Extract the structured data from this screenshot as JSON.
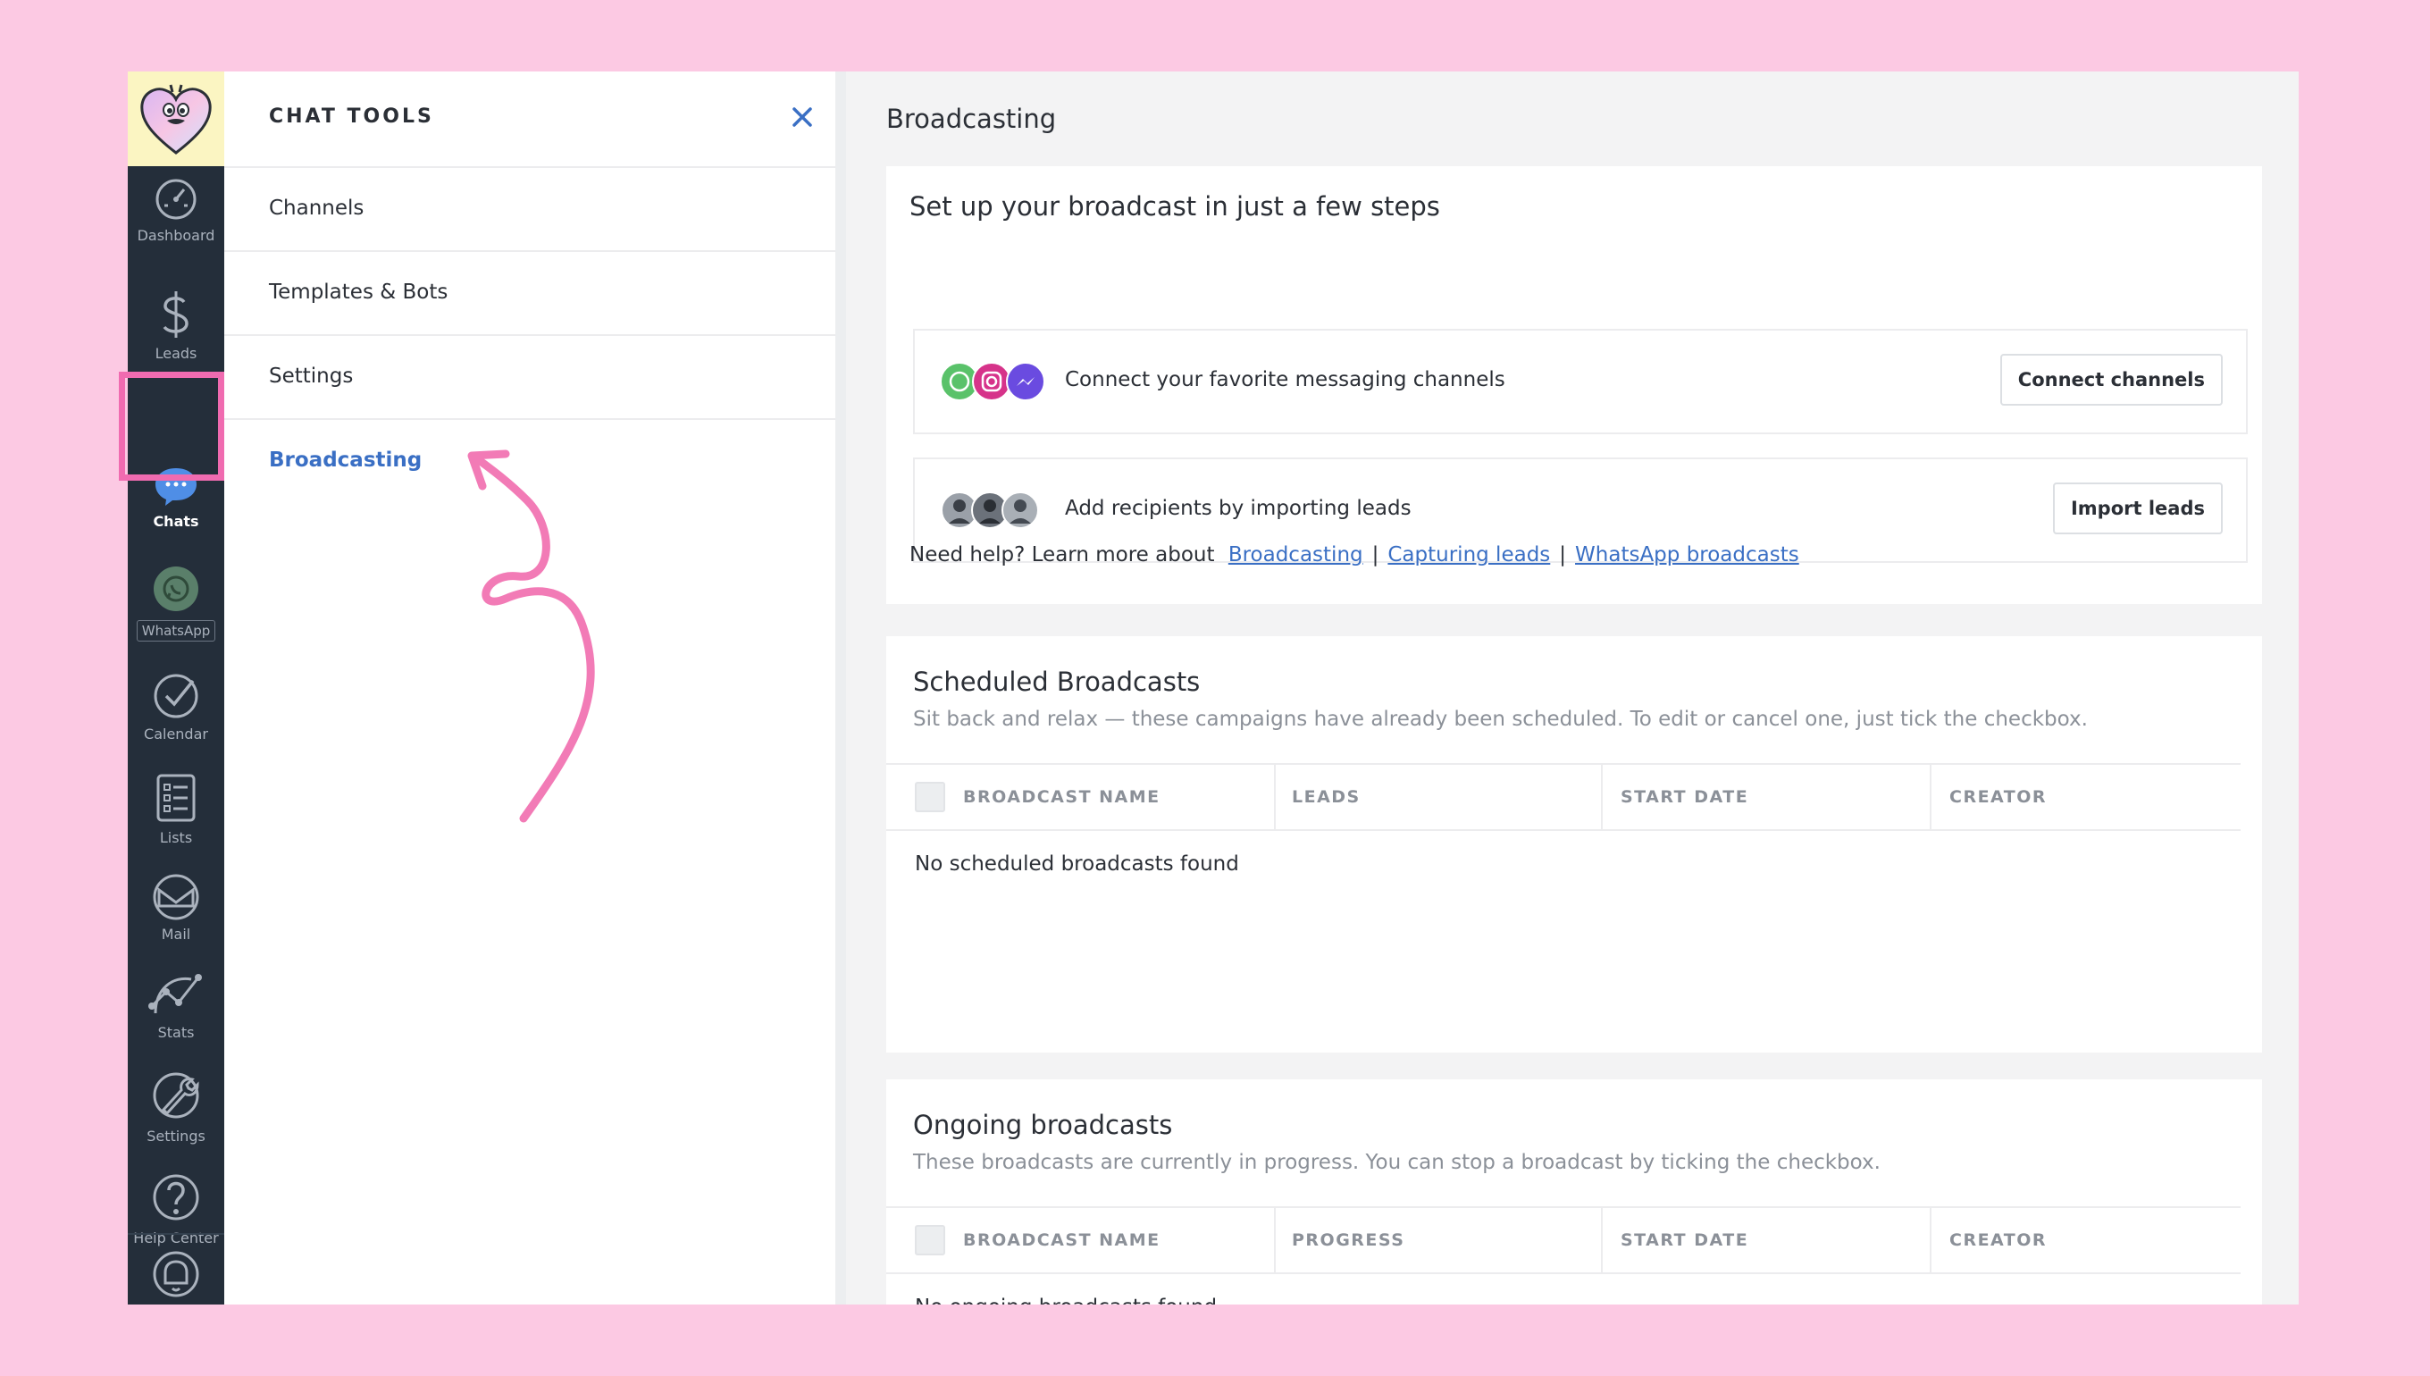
{
  "rail": {
    "items": [
      {
        "label": "Dashboard",
        "icon": "dashboard-gauge-icon"
      },
      {
        "label": "Leads",
        "icon": "dollar-icon"
      },
      {
        "label": "Chats",
        "icon": "chat-bubble-icon"
      },
      {
        "label": "WhatsApp",
        "icon": "whatsapp-icon"
      },
      {
        "label": "Calendar",
        "icon": "checkmark-circle-icon"
      },
      {
        "label": "Lists",
        "icon": "list-icon"
      },
      {
        "label": "Mail",
        "icon": "mail-icon"
      },
      {
        "label": "Stats",
        "icon": "stats-icon"
      },
      {
        "label": "Settings",
        "icon": "wrench-icon"
      },
      {
        "label": "Help Center",
        "icon": "question-icon"
      }
    ],
    "bottom_icon": "bell-icon",
    "active": "Chats"
  },
  "tools": {
    "title": "CHAT TOOLS",
    "items": [
      "Channels",
      "Templates & Bots",
      "Settings",
      "Broadcasting"
    ],
    "active": "Broadcasting"
  },
  "main": {
    "title": "Broadcasting",
    "setup": {
      "heading": "Set up your broadcast in just a few steps",
      "step1_text": "Connect your favorite messaging channels",
      "step1_button": "Connect channels",
      "step2_text": "Add recipients by importing leads",
      "step2_button": "Import leads",
      "help_prefix": "Need help? Learn more about",
      "links": [
        "Broadcasting",
        "Capturing leads",
        "WhatsApp broadcasts"
      ],
      "separator": "|"
    },
    "scheduled": {
      "title": "Scheduled Broadcasts",
      "description": "Sit back and relax — these campaigns have already been scheduled. To edit or cancel one, just tick the checkbox.",
      "columns": [
        "BROADCAST NAME",
        "LEADS",
        "START DATE",
        "CREATOR"
      ],
      "empty": "No scheduled broadcasts found"
    },
    "ongoing": {
      "title": "Ongoing broadcasts",
      "description": "These broadcasts are currently in progress. You can stop a broadcast by ticking the checkbox.",
      "columns": [
        "BROADCAST NAME",
        "PROGRESS",
        "START DATE",
        "CREATOR"
      ],
      "empty": "No ongoing broadcasts found"
    }
  },
  "colors": {
    "background": "#fcc9e3",
    "rail": "#242e3a",
    "accent": "#3a6fc4",
    "highlight": "#f06bb0"
  }
}
